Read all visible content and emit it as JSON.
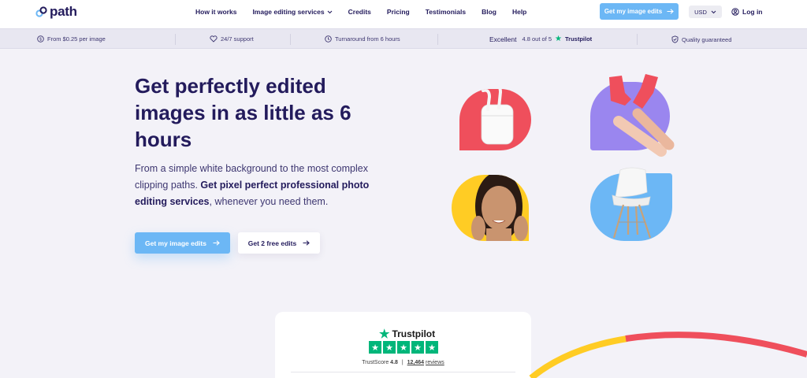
{
  "header": {
    "logo_text": "path",
    "nav": [
      {
        "label": "How it works"
      },
      {
        "label": "Image editing services",
        "has_dropdown": true
      },
      {
        "label": "Credits"
      },
      {
        "label": "Pricing"
      },
      {
        "label": "Testimonials"
      },
      {
        "label": "Blog"
      },
      {
        "label": "Help"
      }
    ],
    "cta_label": "Get my image edits",
    "currency": "USD",
    "login_label": "Log in"
  },
  "infobar": {
    "price": "From $0.25 per image",
    "support": "24/7 support",
    "turnaround": "Turnaround from 6 hours",
    "tp_excellent": "Excellent",
    "tp_rating": "4.8 out of 5",
    "tp_brand": "Trustpilot",
    "quality": "Quality guaranteed"
  },
  "hero": {
    "title": "Get perfectly edited images in as little as 6 hours",
    "sub_plain_1": "From a simple white background to the most complex clipping paths. ",
    "sub_bold": "Get pixel perfect professional photo editing services",
    "sub_plain_2": ", whenever you need them.",
    "primary_button": "Get my image edits",
    "secondary_button": "Get 2 free edits"
  },
  "showcase": {
    "colors": {
      "earbuds": "#ef4f5c",
      "shoes": "#9a86ef",
      "face": "#ffcc24",
      "chair": "#6cb7f5"
    }
  },
  "trustpilot_card": {
    "brand": "Trustpilot",
    "stars": 5,
    "score_label": "TrustScore",
    "score": "4.8",
    "separator": "|",
    "reviews_count": "12,464",
    "reviews_label": "reviews"
  },
  "colors": {
    "primary": "#6cb7f5",
    "navy": "#231b5c",
    "trustpilot_green": "#00b67a",
    "background": "#f3f2f8"
  }
}
